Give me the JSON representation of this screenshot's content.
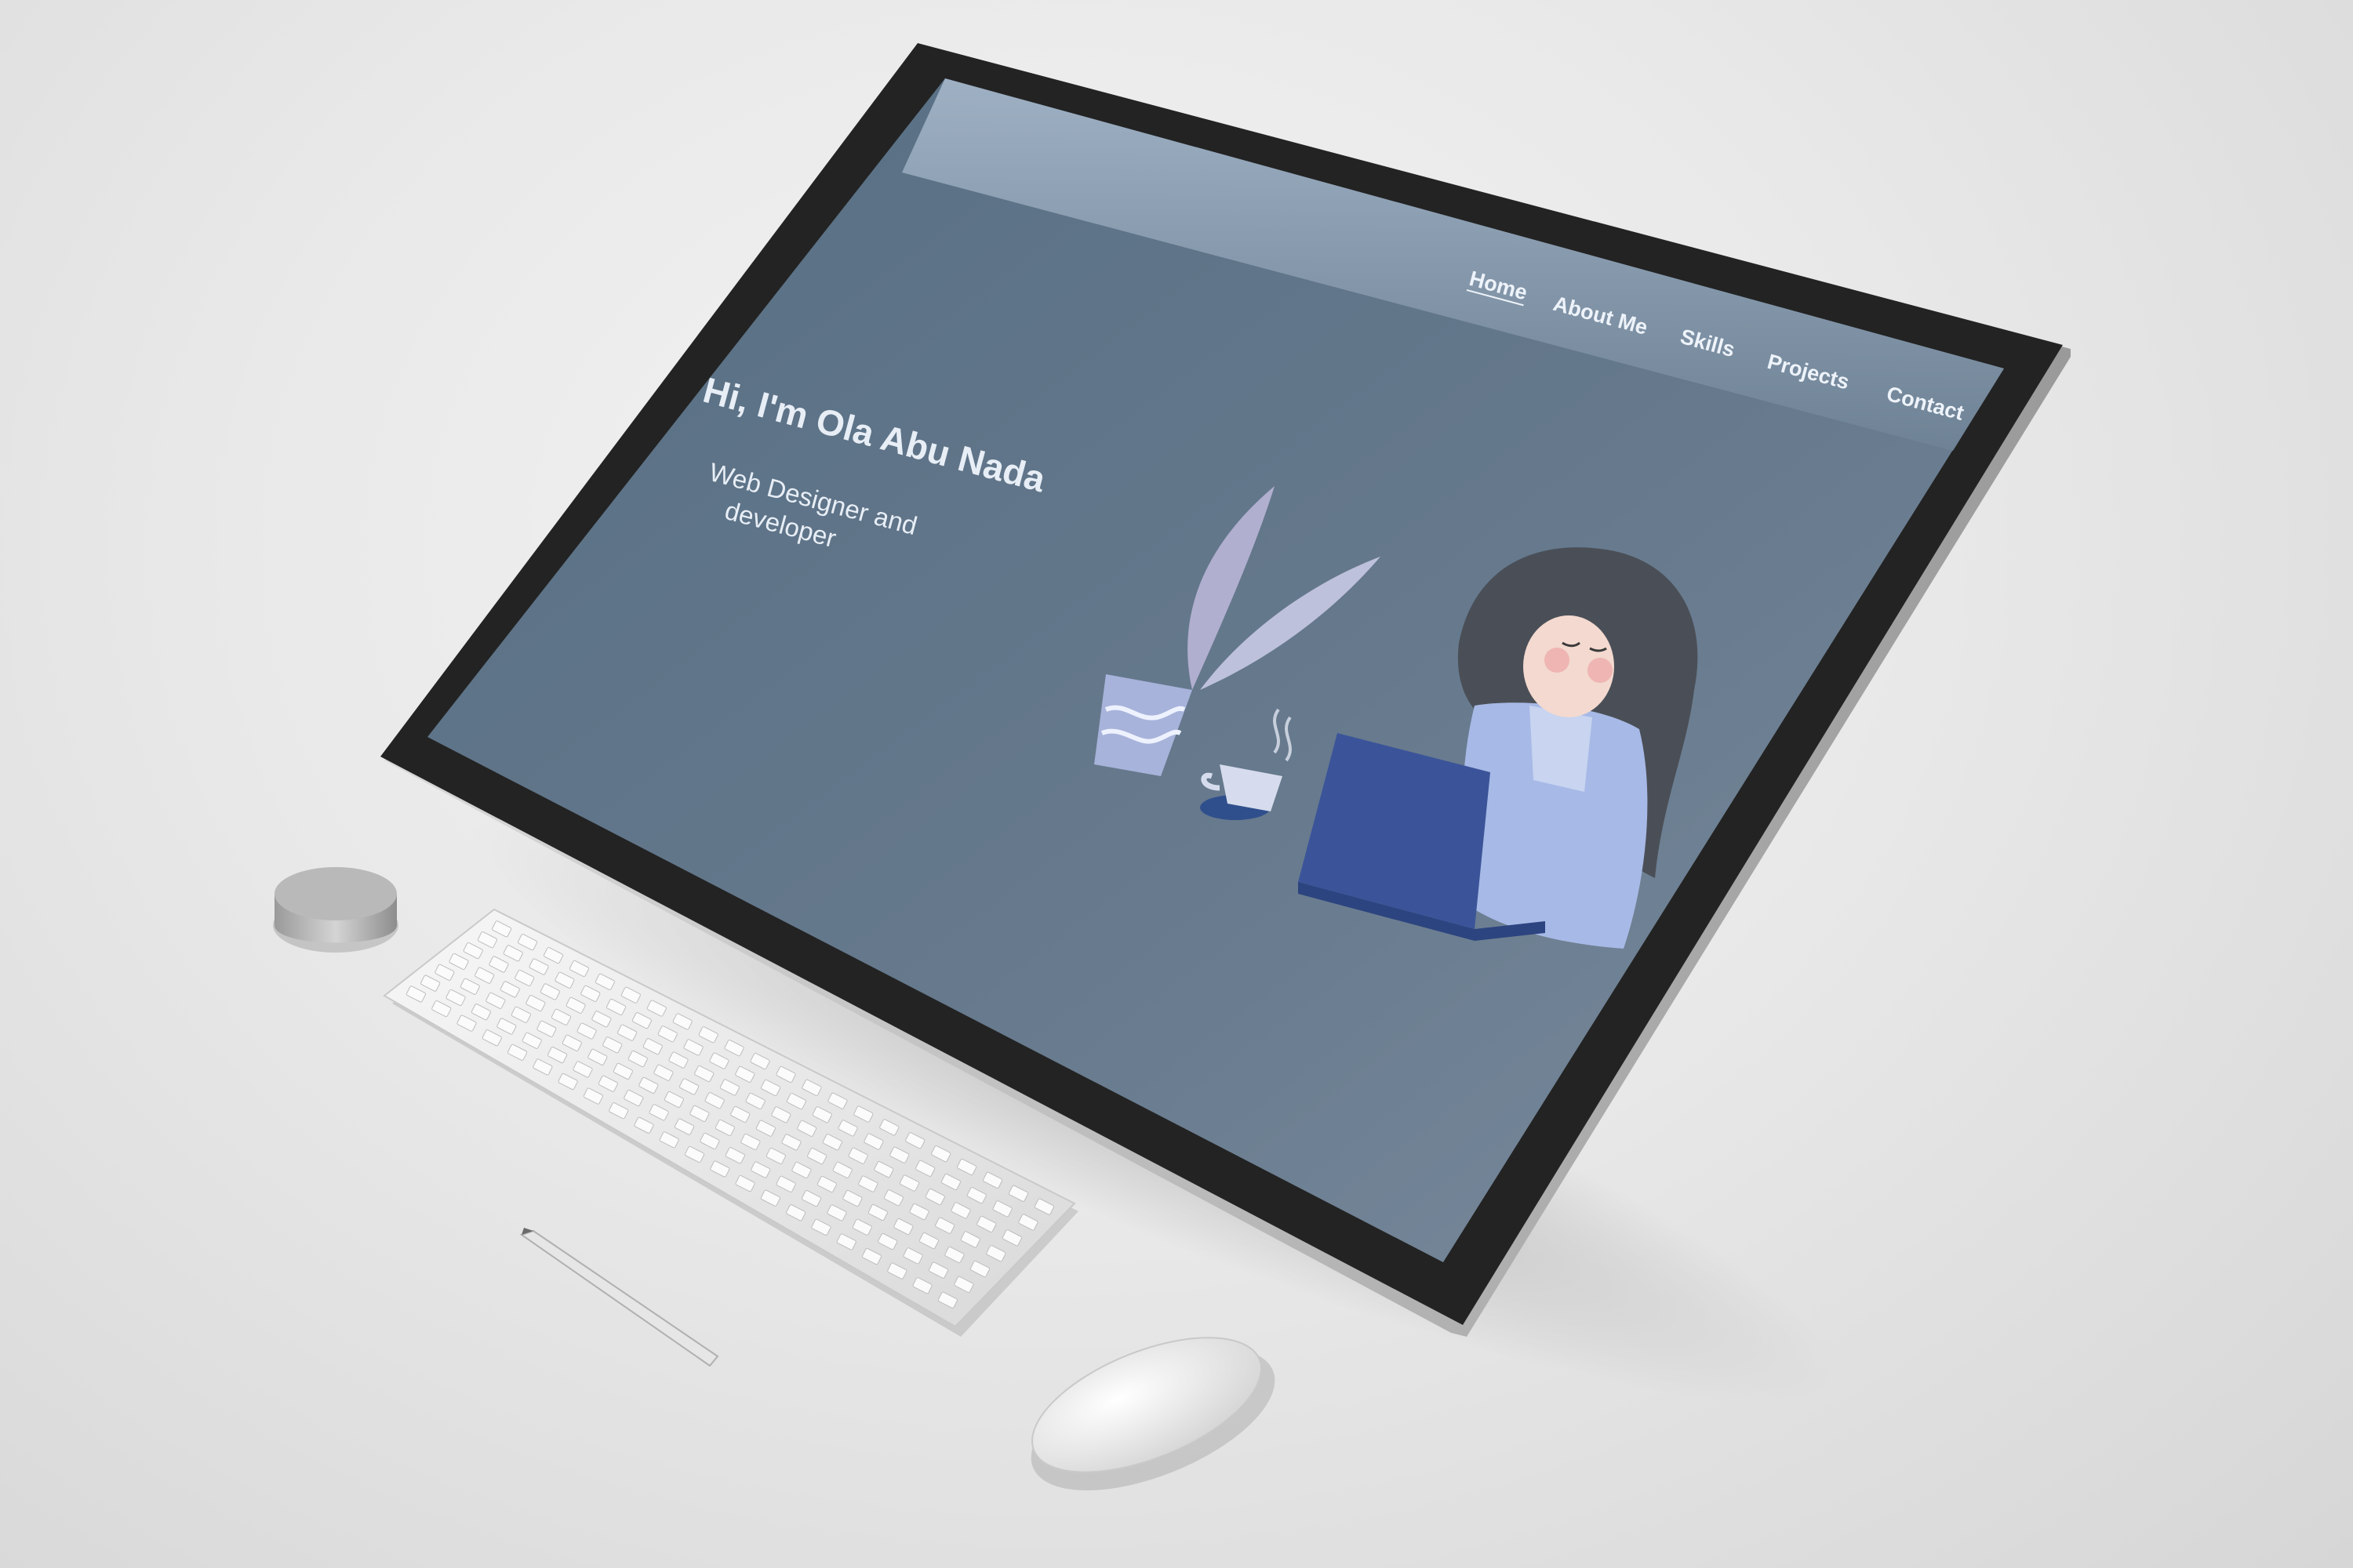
{
  "site": {
    "nav": {
      "items": [
        {
          "label": "Home",
          "active": true
        },
        {
          "label": "About Me",
          "active": false
        },
        {
          "label": "Skills",
          "active": false
        },
        {
          "label": "Projects",
          "active": false
        },
        {
          "label": "Contact",
          "active": false
        }
      ]
    },
    "hero": {
      "greeting": "Hi, I'm Ola Abu Nada",
      "role_line1": "Web Designer and",
      "role_line2": "developer"
    }
  },
  "colors": {
    "screen_bg": "#657c91",
    "nav_bar": "#9db0c4",
    "text": "#e8eef6",
    "laptop": "#3b5499",
    "jacket": "#a7b9e6",
    "hair": "#4a4f57",
    "bezel": "#232323"
  },
  "icons": [
    "plant-illustration",
    "coffee-cup-illustration",
    "woman-with-laptop-illustration"
  ]
}
